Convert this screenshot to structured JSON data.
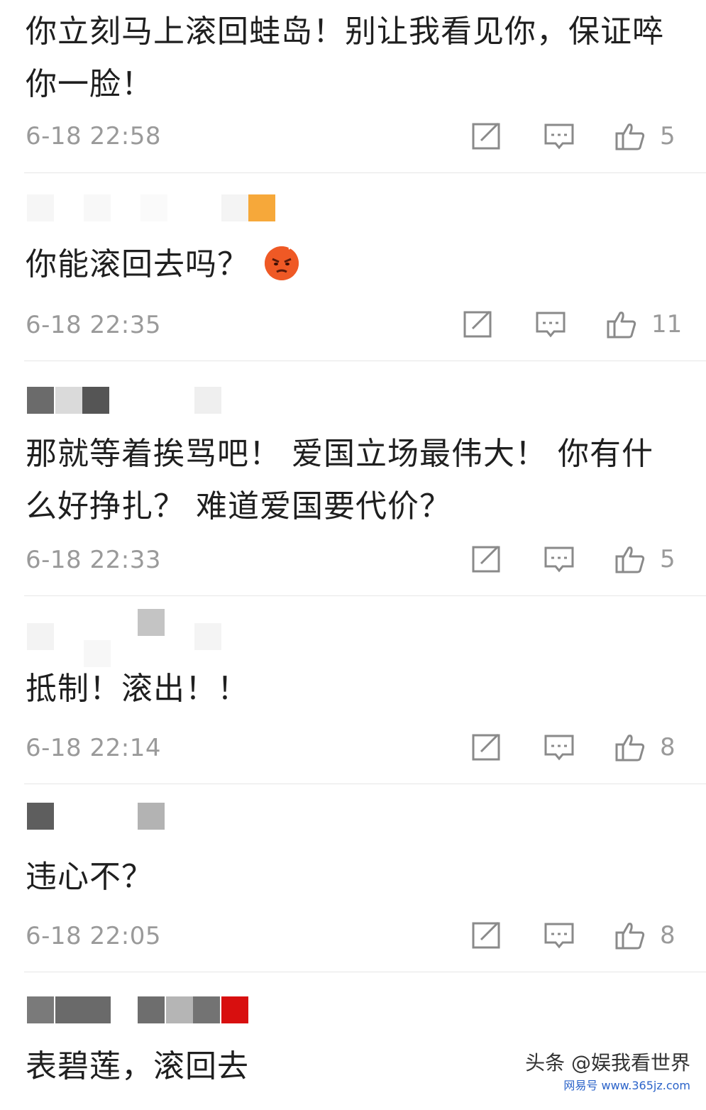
{
  "comments": [
    {
      "text": "你立刻马上滚回蛙岛！别让我看见你，保证啐你一脸！",
      "time": "6-18 22:58",
      "likes": "5"
    },
    {
      "text": "你能滚回去吗？",
      "emoji": "angry-face-emoji",
      "time": "6-18 22:35",
      "likes": "11"
    },
    {
      "text": "那就等着挨骂吧！ 爱国立场最伟大！ 你有什么好挣扎？ 难道爱国要代价？",
      "time": "6-18 22:33",
      "likes": "5"
    },
    {
      "text": "抵制！滚出！！",
      "time": "6-18 22:14",
      "likes": "8"
    },
    {
      "text": "违心不？",
      "time": "6-18 22:05",
      "likes": "8"
    },
    {
      "text": "表碧莲，滚回去"
    }
  ],
  "icons": {
    "edit": "edit-icon",
    "reply": "comment-icon",
    "like": "thumbs-up-icon"
  },
  "watermark": {
    "main": "头条 @娱我看世界",
    "sub": "网易号 www.365jz.com"
  },
  "colors": {
    "timestamp": "#9a9a9a",
    "text": "#1f1f1f",
    "divider": "#e6e6e6"
  }
}
